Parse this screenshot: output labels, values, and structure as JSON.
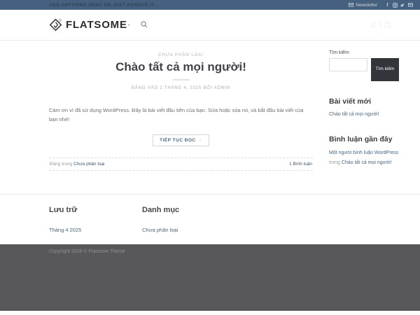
{
  "topbar": {
    "left_text": "ADD ANYTHING HERE OR JUST REMOVE IT...",
    "newsletter_label": "Newsletter",
    "social_icons": [
      "facebook",
      "instagram",
      "twitter",
      "email"
    ]
  },
  "header": {
    "logo_text": "FLATSOME",
    "registered_mark": "®"
  },
  "post": {
    "category": "CHƯA PHÂN LOẠI",
    "title": "Chào tất cả mọi người!",
    "meta": "ĐĂNG VÀO 1 THÁNG 4, 2025 BỞI ADMIN",
    "excerpt": "Cảm ơn vì đã sử dụng WordPress. Đây là bài viết đầu tiên của bạn. Sửa hoặc xóa nó, và bắt đầu bài viết của bạn nhé!",
    "read_more_label": "TIẾP TỤC ĐỌC",
    "read_more_arrow": "→",
    "posted_in_label": "Đăng trong",
    "posted_in_category": "Chưa phân loại",
    "comments_link": "1 Bình luận"
  },
  "sidebar": {
    "search": {
      "label": "Tìm kiếm",
      "button_label": "Tìm kiếm"
    },
    "recent_posts": {
      "title": "Bài viết mới",
      "items": [
        "Chào tất cả mọi người!"
      ]
    },
    "recent_comments": {
      "title": "Bình luận gần đây",
      "author_link": "Một người bình luận WordPress",
      "connector": " trong ",
      "post_link": "Chào tất cả mọi người!"
    }
  },
  "footer": {
    "archives": {
      "title": "Lưu trữ",
      "items": [
        "Tháng 4 2025"
      ]
    },
    "categories": {
      "title": "Danh mục",
      "items": [
        "Chưa phân loại"
      ]
    },
    "copyright": "Copyright 2026 © Flatsome Theme"
  },
  "colors": {
    "topbar_bg": "#46617f",
    "link_accent": "#49657f",
    "search_button_bg": "#32353a",
    "absolute_footer_bg": "#58585a",
    "heading_text": "#42424a"
  }
}
